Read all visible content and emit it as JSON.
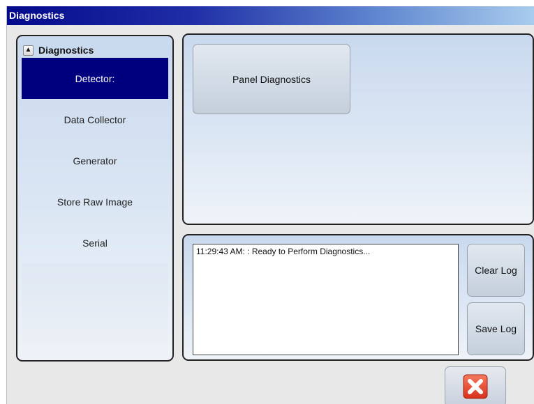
{
  "window": {
    "title": "Diagnostics"
  },
  "nav": {
    "header": "Diagnostics",
    "collapse_icon": "chevron-up-icon",
    "items": [
      {
        "label": "Detector:",
        "selected": true
      },
      {
        "label": "Data Collector",
        "selected": false
      },
      {
        "label": "Generator",
        "selected": false
      },
      {
        "label": "Store Raw Image",
        "selected": false
      },
      {
        "label": "Serial",
        "selected": false
      }
    ],
    "selected_color": "#00007f"
  },
  "diagnostics": {
    "panel_button": "Panel Diagnostics"
  },
  "log": {
    "lines": [
      "11:29:43 AM: : Ready to Perform Diagnostics..."
    ],
    "clear_label": "Clear Log",
    "save_label": "Save Log"
  },
  "footer": {
    "close_icon": "close-x-icon",
    "close_color": "#e8432c"
  }
}
